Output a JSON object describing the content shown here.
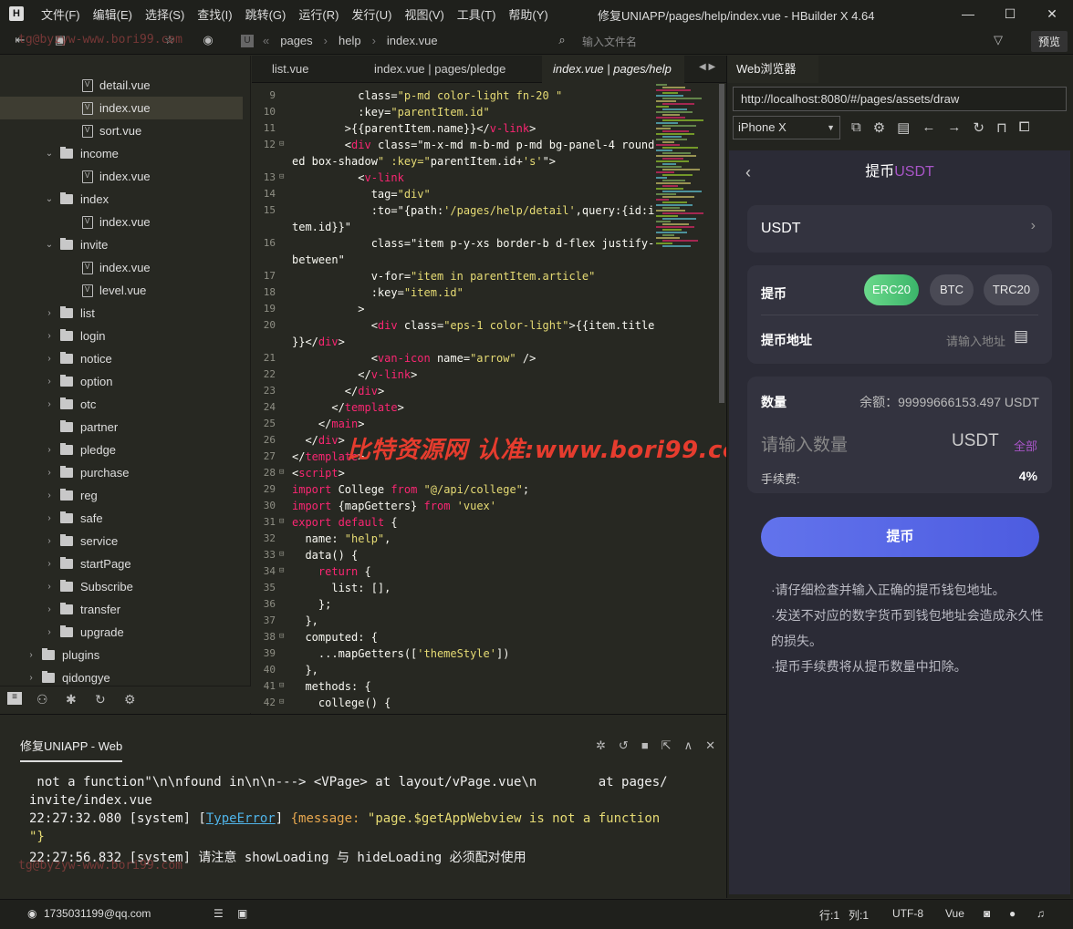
{
  "titlebar": {
    "logo": "H",
    "menu": [
      "文件(F)",
      "编辑(E)",
      "选择(S)",
      "查找(I)",
      "跳转(G)",
      "运行(R)",
      "发行(U)",
      "视图(V)",
      "工具(T)",
      "帮助(Y)"
    ],
    "title": "修复UNIAPP/pages/help/index.vue - HBuilder X 4.64",
    "min": "—",
    "max": "☐",
    "close": "✕"
  },
  "toolbar": {
    "breadcrumbs": [
      "pages",
      "help",
      "index.vue"
    ],
    "file_search_placeholder": "输入文件名",
    "preview": "预览",
    "watermark": "tg@byzyw-www.bori99.com"
  },
  "tree": [
    {
      "label": "detail.vue",
      "type": "file",
      "depth": 2
    },
    {
      "label": "index.vue",
      "type": "file",
      "depth": 2,
      "selected": true
    },
    {
      "label": "sort.vue",
      "type": "file",
      "depth": 2
    },
    {
      "label": "income",
      "type": "dir",
      "depth": 1,
      "open": true
    },
    {
      "label": "index.vue",
      "type": "file",
      "depth": 2
    },
    {
      "label": "index",
      "type": "dir",
      "depth": 1,
      "open": true
    },
    {
      "label": "index.vue",
      "type": "file",
      "depth": 2
    },
    {
      "label": "invite",
      "type": "dir",
      "depth": 1,
      "open": true
    },
    {
      "label": "index.vue",
      "type": "file",
      "depth": 2
    },
    {
      "label": "level.vue",
      "type": "file",
      "depth": 2
    },
    {
      "label": "list",
      "type": "dir",
      "depth": 1
    },
    {
      "label": "login",
      "type": "dir",
      "depth": 1
    },
    {
      "label": "notice",
      "type": "dir",
      "depth": 1
    },
    {
      "label": "option",
      "type": "dir",
      "depth": 1
    },
    {
      "label": "otc",
      "type": "dir",
      "depth": 1
    },
    {
      "label": "partner",
      "type": "dir",
      "depth": 1,
      "nocaret": true
    },
    {
      "label": "pledge",
      "type": "dir",
      "depth": 1
    },
    {
      "label": "purchase",
      "type": "dir",
      "depth": 1
    },
    {
      "label": "reg",
      "type": "dir",
      "depth": 1
    },
    {
      "label": "safe",
      "type": "dir",
      "depth": 1
    },
    {
      "label": "service",
      "type": "dir",
      "depth": 1
    },
    {
      "label": "startPage",
      "type": "dir",
      "depth": 1
    },
    {
      "label": "Subscribe",
      "type": "dir",
      "depth": 1
    },
    {
      "label": "transfer",
      "type": "dir",
      "depth": 1
    },
    {
      "label": "upgrade",
      "type": "dir",
      "depth": 1
    },
    {
      "label": "plugins",
      "type": "dir",
      "depth": 0
    },
    {
      "label": "qidongye",
      "type": "dir",
      "depth": 0
    }
  ],
  "editor_tabs": [
    "list.vue",
    "index.vue | pages/pledge",
    "index.vue | pages/help"
  ],
  "code": [
    {
      "n": "9",
      "t": "          class=\"p-md color-light fn-20 \""
    },
    {
      "n": "10",
      "t": "          :key=\"parentItem.id\""
    },
    {
      "n": "11",
      "t": "        >{{parentItem.name}}</v-link>"
    },
    {
      "n": "12",
      "t": "        <div class=\"m-x-md m-b-md p-md bg-panel-4 round",
      "f": "⊟"
    },
    {
      "n": "",
      "t": "ed box-shadow\" :key=\"parentItem.id+'s'\">"
    },
    {
      "n": "13",
      "t": "          <v-link",
      "f": "⊟"
    },
    {
      "n": "14",
      "t": "            tag=\"div\""
    },
    {
      "n": "15",
      "t": "            :to=\"{path:'/pages/help/detail',query:{id:i"
    },
    {
      "n": "",
      "t": "tem.id}}\""
    },
    {
      "n": "16",
      "t": "            class=\"item p-y-xs border-b d-flex justify-"
    },
    {
      "n": "",
      "t": "between\""
    },
    {
      "n": "17",
      "t": "            v-for=\"item in parentItem.article\""
    },
    {
      "n": "18",
      "t": "            :key=\"item.id\""
    },
    {
      "n": "19",
      "t": "          >"
    },
    {
      "n": "20",
      "t": "            <div class=\"eps-1 color-light\">{{item.title"
    },
    {
      "n": "",
      "t": "}}</div>"
    },
    {
      "n": "21",
      "t": "            <van-icon name=\"arrow\" />"
    },
    {
      "n": "22",
      "t": "          </v-link>"
    },
    {
      "n": "23",
      "t": "        </div>"
    },
    {
      "n": "24",
      "t": "      </template>"
    },
    {
      "n": "25",
      "t": "    </main>"
    },
    {
      "n": "26",
      "t": "  </div>"
    },
    {
      "n": "27",
      "t": "</template>"
    },
    {
      "n": "28",
      "t": "<script>",
      "f": "⊟"
    },
    {
      "n": "29",
      "t": "import College from \"@/api/college\";"
    },
    {
      "n": "30",
      "t": "import {mapGetters} from 'vuex'"
    },
    {
      "n": "31",
      "t": "export default {",
      "f": "⊟"
    },
    {
      "n": "32",
      "t": "  name: \"help\","
    },
    {
      "n": "33",
      "t": "  data() {",
      "f": "⊟"
    },
    {
      "n": "34",
      "t": "    return {",
      "f": "⊟"
    },
    {
      "n": "35",
      "t": "      list: [],"
    },
    {
      "n": "36",
      "t": "    };"
    },
    {
      "n": "37",
      "t": "  },"
    },
    {
      "n": "38",
      "t": "  computed: {",
      "f": "⊟"
    },
    {
      "n": "39",
      "t": "    ...mapGetters(['themeStyle'])"
    },
    {
      "n": "40",
      "t": "  },"
    },
    {
      "n": "41",
      "t": "  methods: {",
      "f": "⊟"
    },
    {
      "n": "42",
      "t": "    college() {",
      "f": "⊟"
    }
  ],
  "watermark_main": "比特资源网 认准:www.bori99.com",
  "console": {
    "tab": "修复UNIAPP - Web",
    "lines": [
      " not a function\"\\n\\nfound in\\n\\n---> <VPage> at layout/vPage.vue\\n        at pages/",
      "invite/index.vue",
      "22:27:32.080 [system] [TypeError] {message: \"page.$getAppWebview is not a function",
      "\"}",
      "22:27:56.832 [system] 请注意 showLoading 与 hideLoading 必须配对使用"
    ],
    "watermark": "tg@byzyw-www.bori99.com"
  },
  "status": {
    "user": "1735031199@qq.com",
    "row": "行:1",
    "col": "列:1",
    "encoding": "UTF-8",
    "lang": "Vue"
  },
  "browser": {
    "tab": "Web浏览器",
    "url": "http://localhost:8080/#/pages/assets/draw",
    "device": "iPhone X"
  },
  "app": {
    "title_a": "提币",
    "title_b": "USDT",
    "coin": "USDT",
    "chain_label": "提币",
    "chains": [
      "ERC20",
      "BTC",
      "TRC20"
    ],
    "address_label": "提币地址",
    "address_placeholder": "请输入地址",
    "amount_label": "数量",
    "balance": "余额：99999666153.497 USDT",
    "amount_placeholder": "请输入数量",
    "amount_unit": "USDT",
    "all": "全部",
    "fee_label": "手续费:",
    "fee": "4%",
    "submit": "提币",
    "tips": [
      "·请仔细检查并输入正确的提币钱包地址。",
      "·发送不对应的数字货币到钱包地址会造成永久性的损失。",
      "·提币手续费将从提币数量中扣除。"
    ]
  },
  "colors": {
    "accent": "#a855c7",
    "chain_active": "#3bb56a",
    "button": "#5565e6"
  }
}
